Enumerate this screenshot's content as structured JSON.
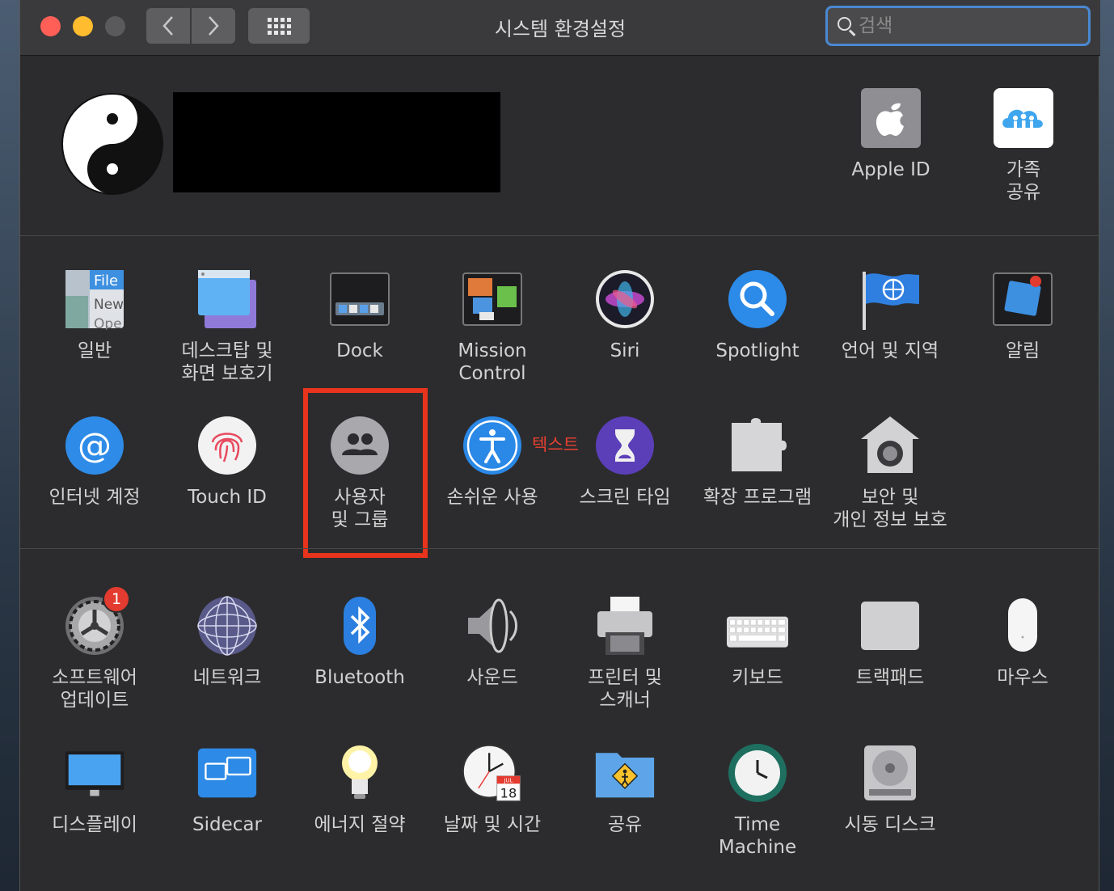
{
  "window": {
    "title": "시스템 환경설정",
    "search_placeholder": "검색"
  },
  "account": {
    "items": [
      {
        "label": "Apple ID",
        "icon": "apple-id-icon"
      },
      {
        "label": "가족\n공유",
        "icon": "family-sharing-icon"
      }
    ]
  },
  "row1": [
    {
      "label": "일반",
      "icon": "general-icon"
    },
    {
      "label": "데스크탑 및\n화면 보호기",
      "icon": "desktop-screensaver-icon"
    },
    {
      "label": "Dock",
      "icon": "dock-icon"
    },
    {
      "label": "Mission\nControl",
      "icon": "mission-control-icon"
    },
    {
      "label": "Siri",
      "icon": "siri-icon"
    },
    {
      "label": "Spotlight",
      "icon": "spotlight-icon"
    },
    {
      "label": "언어 및 지역",
      "icon": "language-region-icon"
    },
    {
      "label": "알림",
      "icon": "notifications-icon"
    }
  ],
  "row2": [
    {
      "label": "인터넷 계정",
      "icon": "internet-accounts-icon"
    },
    {
      "label": "Touch ID",
      "icon": "touch-id-icon"
    },
    {
      "label": "사용자\n및 그룹",
      "icon": "users-groups-icon"
    },
    {
      "label": "손쉬운 사용",
      "icon": "accessibility-icon"
    },
    {
      "label": "스크린 타임",
      "icon": "screen-time-icon"
    },
    {
      "label": "확장 프로그램",
      "icon": "extensions-icon"
    },
    {
      "label": "보안 및\n개인 정보 보호",
      "icon": "security-privacy-icon"
    }
  ],
  "row3": [
    {
      "label": "소프트웨어\n업데이트",
      "icon": "software-update-icon",
      "badge": "1"
    },
    {
      "label": "네트워크",
      "icon": "network-icon"
    },
    {
      "label": "Bluetooth",
      "icon": "bluetooth-icon"
    },
    {
      "label": "사운드",
      "icon": "sound-icon"
    },
    {
      "label": "프린터 및\n스캐너",
      "icon": "printers-scanners-icon"
    },
    {
      "label": "키보드",
      "icon": "keyboard-icon"
    },
    {
      "label": "트랙패드",
      "icon": "trackpad-icon"
    },
    {
      "label": "마우스",
      "icon": "mouse-icon"
    }
  ],
  "row4": [
    {
      "label": "디스플레이",
      "icon": "displays-icon"
    },
    {
      "label": "Sidecar",
      "icon": "sidecar-icon"
    },
    {
      "label": "에너지 절약",
      "icon": "energy-saver-icon"
    },
    {
      "label": "날짜 및 시간",
      "icon": "date-time-icon"
    },
    {
      "label": "공유",
      "icon": "sharing-icon"
    },
    {
      "label": "Time\nMachine",
      "icon": "time-machine-icon"
    },
    {
      "label": "시동 디스크",
      "icon": "startup-disk-icon"
    }
  ],
  "annotation": {
    "text": "텍스트",
    "color": "#e8341c"
  },
  "calendar_icon": {
    "month": "JUL",
    "day": "18"
  }
}
